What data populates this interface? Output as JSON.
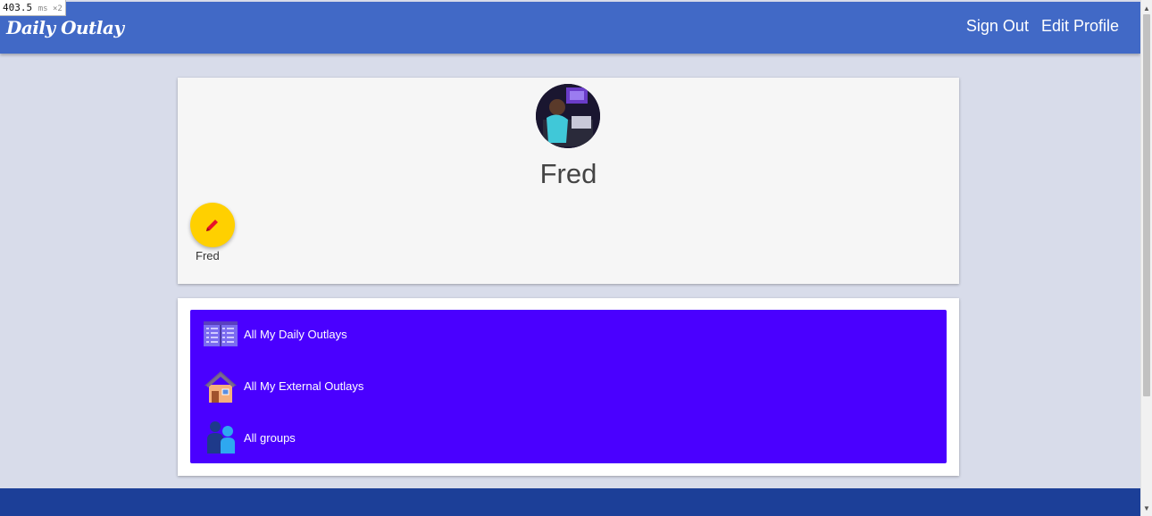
{
  "perf": {
    "value": "403.5",
    "unit": "ms ×2"
  },
  "navbar": {
    "brand": "Daily Outlay",
    "links": [
      {
        "label": "Sign Out",
        "icon": ""
      },
      {
        "label": "Edit Profile",
        "icon": ""
      }
    ]
  },
  "profile": {
    "name": "Fred",
    "edit_button_label": "Fred",
    "edit_icon": "pencil-icon",
    "fab_color": "#ffd000"
  },
  "menu": {
    "panel_color": "#4a00ff",
    "items": [
      {
        "label": "All My Daily Outlays",
        "icon": "calendar-icon"
      },
      {
        "label": "All My External Outlays",
        "icon": "house-icon"
      },
      {
        "label": "All groups",
        "icon": "people-icon"
      }
    ]
  },
  "colors": {
    "navbar": "#4169c6",
    "background": "#d8dcea",
    "footer": "#1c3f98"
  }
}
